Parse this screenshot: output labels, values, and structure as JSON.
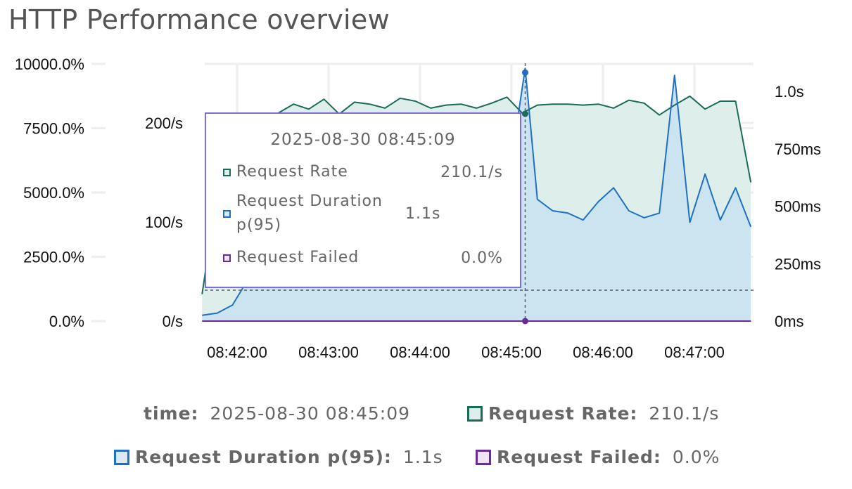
{
  "title": "HTTP Performance overview",
  "chart_data": {
    "type": "area",
    "x_ticks": [
      "08:42:00",
      "08:43:00",
      "08:44:00",
      "08:45:00",
      "08:46:00",
      "08:47:00"
    ],
    "x_range": [
      "08:41:37",
      "08:47:38"
    ],
    "y_left_outer": {
      "ticks": [
        "0.0%",
        "2500.0%",
        "5000.0%",
        "7500.0%",
        "10000.0%"
      ],
      "range": [
        0,
        10000
      ]
    },
    "y_left_inner": {
      "ticks": [
        "0/s",
        "100/s",
        "200/s"
      ],
      "range": [
        0,
        250
      ]
    },
    "y_right": {
      "ticks": [
        "0ms",
        "250ms",
        "500ms",
        "750ms",
        "1.0s"
      ],
      "range": [
        0,
        1.1
      ]
    },
    "grid": true,
    "series": [
      {
        "name": "Request Rate",
        "axis": "rate",
        "color": "#1a6b5a",
        "fill": "#deefeb",
        "x": [
          "08:41:37",
          "08:41:47",
          "08:41:57",
          "08:42:07",
          "08:42:17",
          "08:42:27",
          "08:42:37",
          "08:42:47",
          "08:42:57",
          "08:43:07",
          "08:43:17",
          "08:43:27",
          "08:43:37",
          "08:43:47",
          "08:43:57",
          "08:44:07",
          "08:44:17",
          "08:44:27",
          "08:44:37",
          "08:44:47",
          "08:44:57",
          "08:45:07",
          "08:45:17",
          "08:45:27",
          "08:45:37",
          "08:45:47",
          "08:45:57",
          "08:46:07",
          "08:46:17",
          "08:46:27",
          "08:46:37",
          "08:46:47",
          "08:46:57",
          "08:47:07",
          "08:47:17",
          "08:47:27",
          "08:47:37"
        ],
        "values": [
          27,
          130,
          160,
          190,
          200,
          210,
          219,
          214,
          224,
          209,
          221,
          219,
          215,
          225,
          222,
          215,
          218,
          219,
          215,
          220,
          226,
          210,
          218,
          219,
          219,
          218,
          219,
          215,
          223,
          220,
          208,
          218,
          227,
          214,
          222,
          222,
          140
        ]
      },
      {
        "name": "Request Duration p(95)",
        "axis": "duration",
        "color": "#1f6fc5",
        "fill": "#c9e3f0",
        "x": [
          "08:41:37",
          "08:41:47",
          "08:41:57",
          "08:42:07",
          "08:42:17",
          "08:42:27",
          "08:42:37",
          "08:42:47",
          "08:42:57",
          "08:43:07",
          "08:43:17",
          "08:43:27",
          "08:43:37",
          "08:43:47",
          "08:43:57",
          "08:44:07",
          "08:44:17",
          "08:44:27",
          "08:44:37",
          "08:44:47",
          "08:44:57",
          "08:45:09",
          "08:45:17",
          "08:45:27",
          "08:45:37",
          "08:45:47",
          "08:45:57",
          "08:46:07",
          "08:46:17",
          "08:46:27",
          "08:46:37",
          "08:46:47",
          "08:46:57",
          "08:47:07",
          "08:47:17",
          "08:47:27",
          "08:47:37"
        ],
        "values": [
          0.025,
          0.035,
          0.07,
          0.18,
          0.25,
          0.32,
          0.38,
          0.42,
          0.45,
          0.47,
          0.48,
          0.5,
          0.5,
          0.52,
          0.53,
          0.54,
          0.55,
          0.55,
          0.56,
          0.56,
          0.57,
          1.1,
          0.53,
          0.48,
          0.47,
          0.44,
          0.52,
          0.58,
          0.48,
          0.45,
          0.47,
          1.07,
          0.43,
          0.64,
          0.44,
          0.58,
          0.41
        ]
      },
      {
        "name": "Request Failed",
        "axis": "percent",
        "color": "#6a2a9e",
        "fill": "#efe3f5",
        "x": [
          "08:41:37",
          "08:47:37"
        ],
        "values": [
          0,
          0
        ]
      }
    ],
    "cursor": {
      "time": "08:45:09",
      "rate": 210.1,
      "duration": 1.1,
      "failed": 0.0
    }
  },
  "tooltip": {
    "time": "2025-08-30 08:45:09",
    "rows": [
      {
        "label": "Request Rate",
        "value": "210.1/s",
        "color": "#1a6b5a",
        "fill": "#deefeb"
      },
      {
        "label": "Request Duration p(95)",
        "value": "1.1s",
        "color": "#1f6fc5",
        "fill": "#dbe9f7"
      },
      {
        "label": "Request Failed",
        "value": "0.0%",
        "color": "#6a2a9e",
        "fill": "#efe3f5"
      }
    ]
  },
  "legend": {
    "time_key": "time:",
    "time_value": "2025-08-30 08:45:09",
    "items": [
      {
        "label": "Request Rate:",
        "value": "210.1/s",
        "color": "#1a6b5a",
        "fill": "#deefeb"
      },
      {
        "label": "Request Duration p(95):",
        "value": "1.1s",
        "color": "#1f6fc5",
        "fill": "#dbe9f7"
      },
      {
        "label": "Request Failed:",
        "value": "0.0%",
        "color": "#6a2a9e",
        "fill": "#efe3f5"
      }
    ]
  }
}
